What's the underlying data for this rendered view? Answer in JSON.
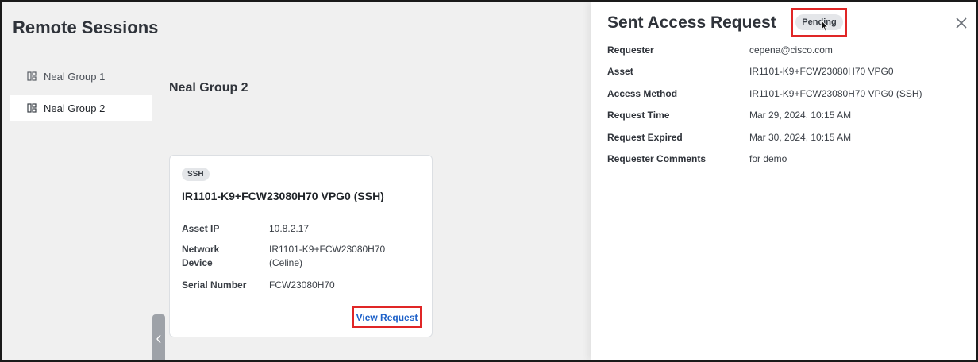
{
  "page": {
    "title": "Remote Sessions"
  },
  "sidebar": {
    "items": [
      {
        "label": "Neal Group 1",
        "active": false
      },
      {
        "label": "Neal Group 2",
        "active": true
      }
    ]
  },
  "main": {
    "group_title": "Neal Group 2",
    "card": {
      "badge": "SSH",
      "title": "IR1101-K9+FCW23080H70 VPG0 (SSH)",
      "rows": [
        {
          "label": "Asset IP",
          "value": "10.8.2.17"
        },
        {
          "label": "Network Device",
          "value": "IR1101-K9+FCW23080H70 (Celine)"
        },
        {
          "label": "Serial Number",
          "value": "FCW23080H70"
        }
      ],
      "action_label": "View Request"
    }
  },
  "drawer": {
    "title": "Sent Access Request",
    "status": "Pending",
    "details": [
      {
        "label": "Requester",
        "value": "cepena@cisco.com"
      },
      {
        "label": "Asset",
        "value": "IR1101-K9+FCW23080H70 VPG0"
      },
      {
        "label": "Access Method",
        "value": "IR1101-K9+FCW23080H70 VPG0 (SSH)"
      },
      {
        "label": "Request Time",
        "value": "Mar 29, 2024, 10:15 AM"
      },
      {
        "label": "Request Expired",
        "value": "Mar 30, 2024, 10:15 AM"
      },
      {
        "label": "Requester Comments",
        "value": "for demo"
      }
    ]
  },
  "colors": {
    "accent_link": "#1f62c9",
    "highlight_box": "#e02626",
    "badge_bg": "#e4e6e9"
  },
  "icons": {
    "sidebar_item": "group-grid-icon",
    "close": "close-icon",
    "collapse": "chevron-left-icon",
    "pointer": "mouse-pointer-icon"
  }
}
